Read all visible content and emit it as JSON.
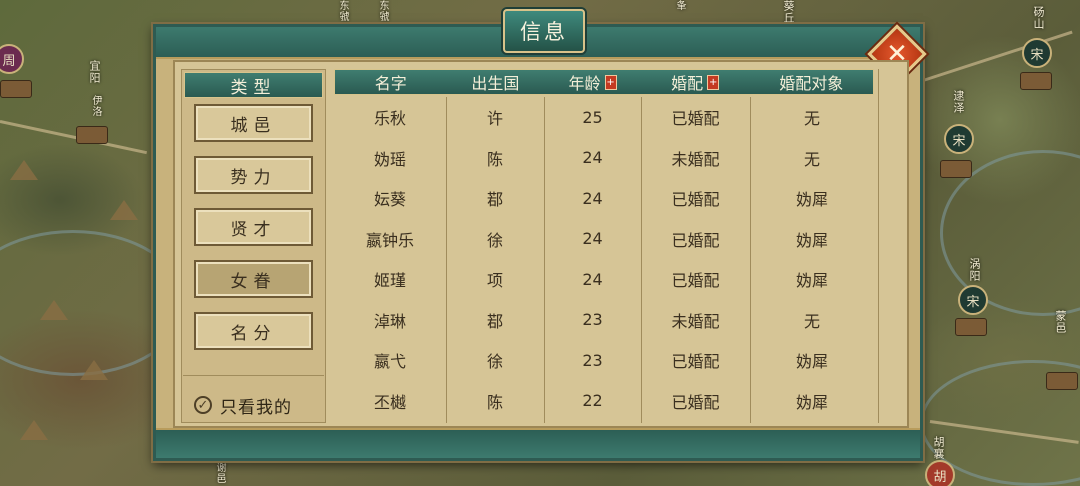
{
  "dialog": {
    "title": "信息",
    "close_label": "✕"
  },
  "categories": {
    "header": "类型",
    "items": [
      {
        "label": "城邑",
        "active": false
      },
      {
        "label": "势力",
        "active": false
      },
      {
        "label": "贤才",
        "active": false
      },
      {
        "label": "女眷",
        "active": true
      },
      {
        "label": "名分",
        "active": false
      }
    ],
    "only_mine_label": "只看我的",
    "only_mine_checked": true
  },
  "table": {
    "headers": [
      "名字",
      "出生国",
      "年龄",
      "婚配",
      "婚配对象"
    ],
    "sortable": [
      false,
      false,
      true,
      true,
      false
    ],
    "sort_icon": "+",
    "rows": [
      [
        "乐秋",
        "许",
        "25",
        "已婚配",
        "无"
      ],
      [
        "妫瑶",
        "陈",
        "24",
        "未婚配",
        "无"
      ],
      [
        "妘葵",
        "鄀",
        "24",
        "已婚配",
        "妫犀"
      ],
      [
        "嬴钟乐",
        "徐",
        "24",
        "已婚配",
        "妫犀"
      ],
      [
        "姬瑾",
        "项",
        "24",
        "已婚配",
        "妫犀"
      ],
      [
        "淖琳",
        "鄀",
        "23",
        "未婚配",
        "无"
      ],
      [
        "嬴弋",
        "徐",
        "23",
        "已婚配",
        "妫犀"
      ],
      [
        "丕樾",
        "陈",
        "22",
        "已婚配",
        "妫犀"
      ]
    ]
  },
  "map": {
    "markers": [
      {
        "label": "宋",
        "name": "宋"
      },
      {
        "label": "宋",
        "name": "宋"
      },
      {
        "label": "宋",
        "name": "宋"
      },
      {
        "label": "宋",
        "name": "宋"
      },
      {
        "label": "周",
        "name": "周"
      }
    ],
    "places": [
      "宜阳",
      "东虢",
      "东虢",
      "夆",
      "葵丘",
      "砀山",
      "逮泽",
      "涡阳",
      "蒙邑",
      "胡襄",
      "胡",
      "谢邑",
      "伊洛"
    ]
  }
}
